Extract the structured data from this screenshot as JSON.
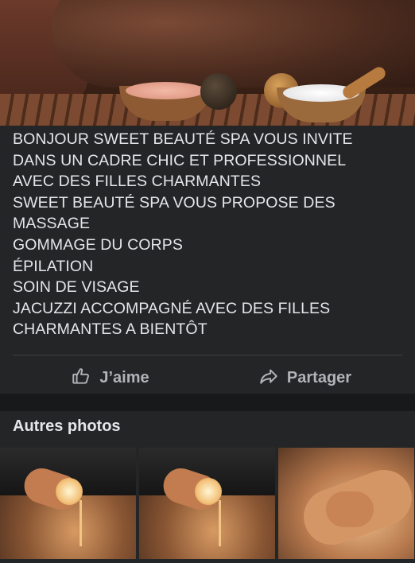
{
  "post": {
    "lines": [
      "BONJOUR SWEET BEAUTÉ SPA VOUS INVITE",
      "DANS UN CADRE CHIC ET PROFESSIONNEL",
      "AVEC DES FILLES CHARMANTES",
      "SWEET BEAUTÉ SPA VOUS PROPOSE DES",
      "MASSAGE",
      "GOMMAGE DU CORPS",
      "ÉPILATION",
      "SOIN DE VISAGE",
      "JACUZZI ACCOMPAGNÉ AVEC DES FILLES",
      "CHARMANTES A BIENTÔT"
    ]
  },
  "actions": {
    "like_label": "J’aime",
    "like_icon": "thumbs-up-icon",
    "share_label": "Partager",
    "share_icon": "share-arrow-icon"
  },
  "others": {
    "title": "Autres photos"
  },
  "colors": {
    "background": "#18191a",
    "card": "#242526",
    "text": "#e4e6eb",
    "muted": "#b0b3b8"
  }
}
